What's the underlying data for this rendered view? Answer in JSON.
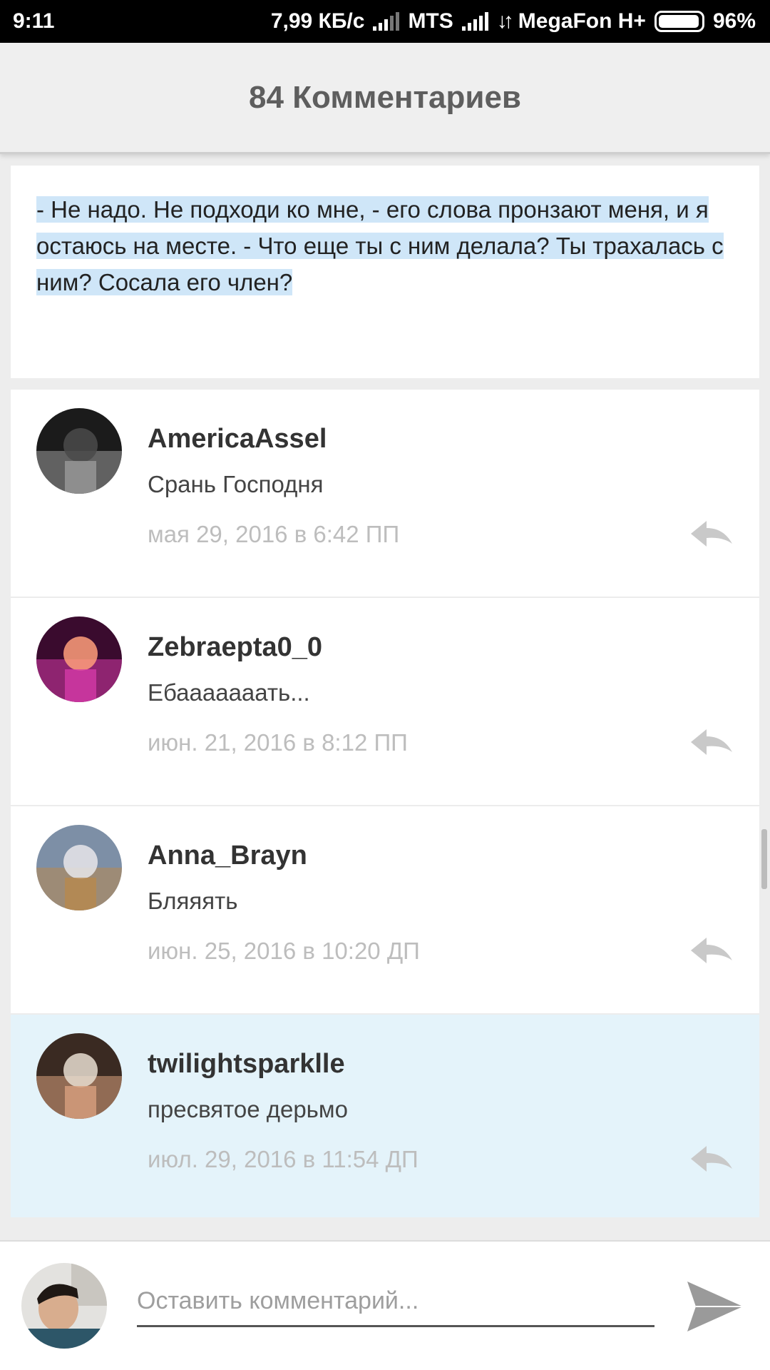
{
  "status_bar": {
    "time": "9:11",
    "net_speed": "7,99 КБ/с",
    "carrier1": "MTS",
    "carrier2": "MegaFon H+",
    "battery": "96%",
    "battery_level": 0.96
  },
  "header": {
    "title": "84 Комментариев"
  },
  "quote": {
    "text": "- Не надо. Не подходи ко мне, - его слова пронзают меня, и я остаюсь на месте. - Что еще ты с ним делала? Ты трахалась с ним? Сосала его член?"
  },
  "comments": [
    {
      "username": "AmericaAssel",
      "text": "Срань Господня",
      "timestamp": "мая 29, 2016 в 6:42 ПП",
      "highlighted": false,
      "avatar_colors": [
        "#1b1b1b",
        "#9a9a9a",
        "#4a4a4a"
      ]
    },
    {
      "username": "Zebraepta0_0",
      "text": "Ебааааааать...",
      "timestamp": "июн. 21, 2016 в 8:12 ПП",
      "highlighted": false,
      "avatar_colors": [
        "#3a0b2e",
        "#d43aa8",
        "#ff9f7a"
      ]
    },
    {
      "username": "Anna_Brayn",
      "text": "Бляяять",
      "timestamp": "июн. 25, 2016 в 10:20 ДП",
      "highlighted": false,
      "avatar_colors": [
        "#7d8fa6",
        "#b8884e",
        "#e8e6ea"
      ]
    },
    {
      "username": "twilightsparklle",
      "text": "пресвятое дерьмо",
      "timestamp": "июл. 29, 2016 в 11:54 ДП",
      "highlighted": true,
      "avatar_colors": [
        "#3a2a22",
        "#d8a07e",
        "#e8ddd0"
      ]
    }
  ],
  "compose": {
    "placeholder": "Оставить комментарий...",
    "value": ""
  },
  "icons": {
    "reply": "reply-arrow-icon",
    "send": "send-icon"
  },
  "colors": {
    "highlight_bg": "#e4f3fa",
    "selection_bg": "#cfe6f8",
    "timestamp": "#bdbdbd",
    "icon_gray": "#c9c9c9"
  }
}
